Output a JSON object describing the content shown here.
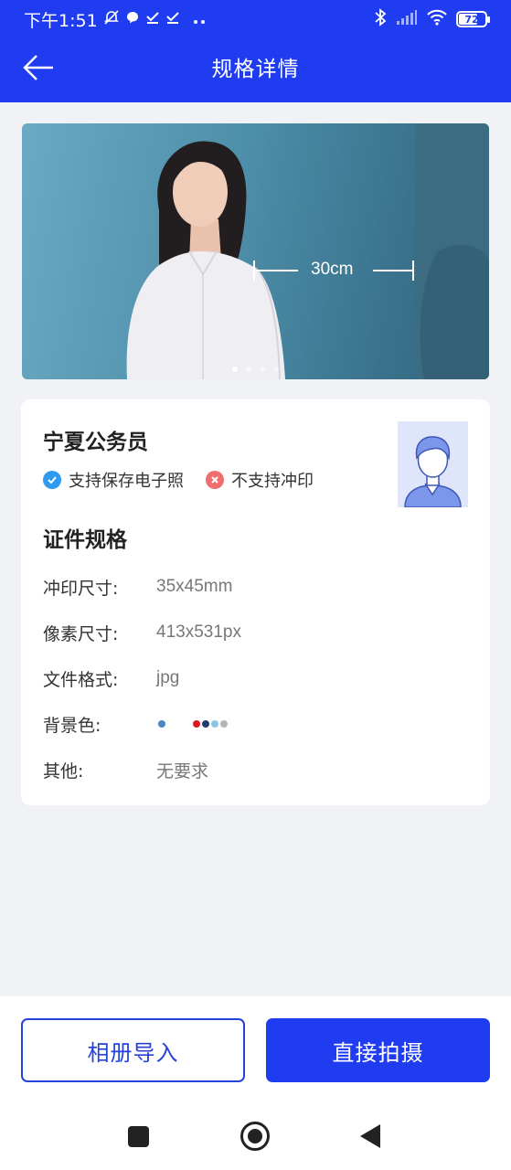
{
  "status_bar": {
    "time": "下午1:51",
    "icons": [
      "silent-icon",
      "message-icon",
      "check-icon",
      "check-icon",
      "more-icon"
    ],
    "right_icons": [
      "bluetooth-icon",
      "signal-icon",
      "wifi-icon"
    ],
    "battery": "72",
    "battery_level": 0.72
  },
  "header": {
    "title": "规格详情",
    "back_icon": "arrow-left-icon",
    "bg_color": "#1f3cf0"
  },
  "banner": {
    "measurement": "30cm",
    "slide_count": 4,
    "active_slide": 0
  },
  "spec": {
    "name": "宁夏公务员",
    "features": [
      {
        "label": "支持保存电子照",
        "status": "ok",
        "icon": "check-circle-icon"
      },
      {
        "label": "不支持冲印",
        "status": "no",
        "icon": "close-circle-icon"
      }
    ],
    "avatar_icon": "person-avatar-icon"
  },
  "details": {
    "section_title": "证件规格",
    "rows": [
      {
        "label": "冲印尺寸:",
        "value": "35x45mm"
      },
      {
        "label": "像素尺寸:",
        "value": "413x531px"
      },
      {
        "label": "文件格式:",
        "value": "jpg"
      },
      {
        "label": "背景色:",
        "value": ""
      },
      {
        "label": "其他:",
        "value": "无要求"
      }
    ],
    "background_colors": [
      "#4a86c5",
      "#ffffff",
      "#e0161e",
      "#1f3b73",
      "#8fc3e8",
      "#b5b5b5"
    ]
  },
  "actions": {
    "album_import": "相册导入",
    "shoot_direct": "直接拍摄"
  },
  "system_nav": {
    "icons": [
      "recent-apps-icon",
      "home-icon",
      "back-icon"
    ]
  }
}
